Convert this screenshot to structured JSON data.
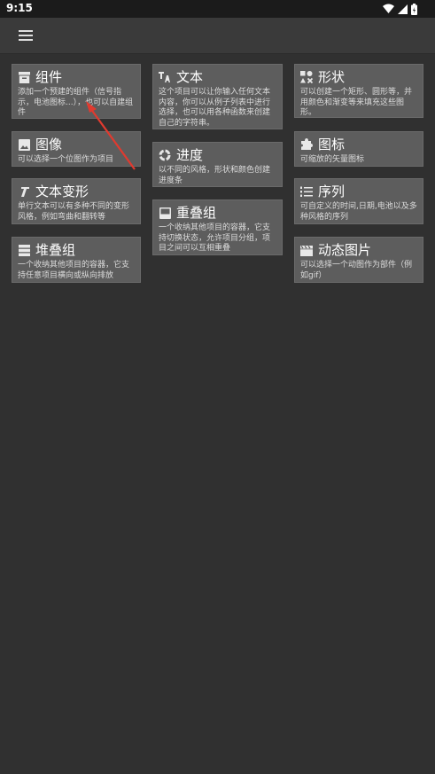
{
  "status_bar": {
    "time": "9:15"
  },
  "cards": {
    "widget": {
      "title": "组件",
      "desc": "添加一个预建的组件（信号指示，电池图标...），也可以自建组件"
    },
    "image": {
      "title": "图像",
      "desc": "可以选择一个位图作为项目"
    },
    "text_transform": {
      "title": "文本变形",
      "desc": "单行文本可以有多种不同的变形风格，例如弯曲和翻转等"
    },
    "stack": {
      "title": "堆叠组",
      "desc": "一个收纳其他项目的容器，它支持任意项目横向或纵向排放"
    },
    "text": {
      "title": "文本",
      "desc": "这个项目可以让你输入任何文本内容，你可以从例子列表中进行选择，也可以用各种函数来创建自己的字符串。"
    },
    "progress": {
      "title": "进度",
      "desc": "以不同的风格，形状和颜色创建进度条"
    },
    "overlap": {
      "title": "重叠组",
      "desc": "一个收纳其他项目的容器，它支持切换状态，允许项目分组，项目之间可以互相重叠"
    },
    "shape": {
      "title": "形状",
      "desc": "可以创建一个矩形、圆形等，并用颜色和渐变等来填充这些图形。"
    },
    "icon": {
      "title": "图标",
      "desc": "可缩放的矢量图标"
    },
    "series": {
      "title": "序列",
      "desc": "可自定义的时间,日期,电池以及多种风格的序列"
    },
    "gif": {
      "title": "动态图片",
      "desc": "可以选择一个动图作为部件（例如gif）"
    }
  },
  "colors": {
    "background": "#303030",
    "card": "#5d5d5d",
    "annotation_arrow": "#e03a2f"
  }
}
